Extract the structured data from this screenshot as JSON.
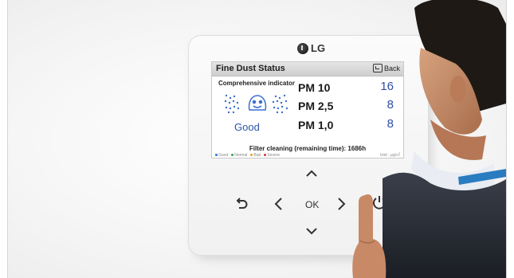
{
  "device": {
    "brand": "LG",
    "screen": {
      "title": "Fine Dust Status",
      "back_label": "Back",
      "comprehensive_label": "Comprehensive indicator",
      "status": "Good",
      "readings": [
        {
          "label": "PM 10",
          "value": "16"
        },
        {
          "label": "PM 2,5",
          "value": "8"
        },
        {
          "label": "PM 1,0",
          "value": "8"
        }
      ],
      "filter_text": "Filter cleaning (remaining time): 1686h",
      "legend": [
        {
          "label": "Good",
          "color": "#2e6fd8"
        },
        {
          "label": "Normal",
          "color": "#2aa84a"
        },
        {
          "label": "Bad",
          "color": "#f0a020"
        },
        {
          "label": "Severe",
          "color": "#d83030"
        }
      ],
      "unit": "Unit : μg/㎥"
    },
    "controls": {
      "ok_label": "OK",
      "up": "up-arrow",
      "down": "down-arrow",
      "left": "left-arrow",
      "right": "right-arrow",
      "back": "return-arrow",
      "power": "power-icon"
    }
  },
  "colors": {
    "accent_blue": "#2e4fa4",
    "indicator_dots": "#3a6fd0"
  }
}
